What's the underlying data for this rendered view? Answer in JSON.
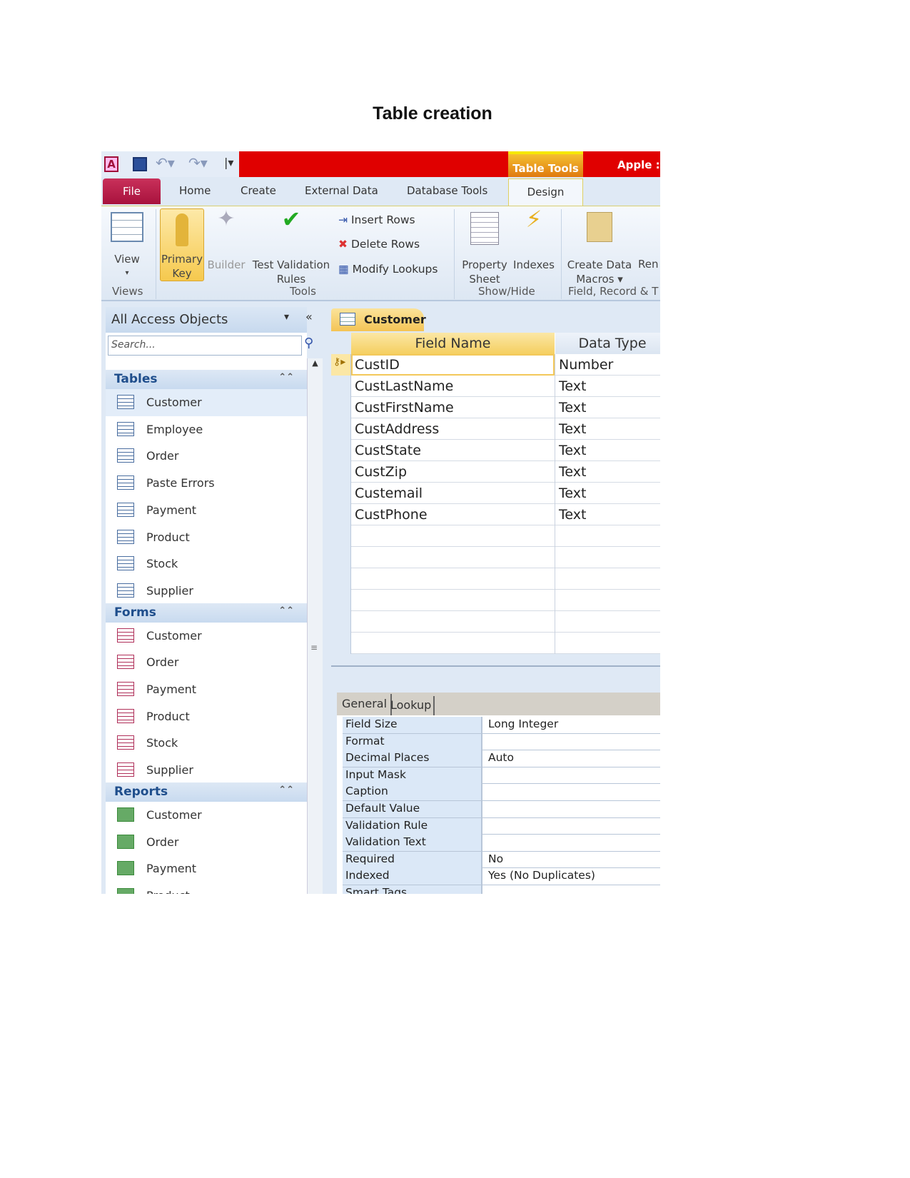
{
  "document": {
    "title": "Table creation"
  },
  "titlebar": {
    "table_tools": "Table Tools",
    "app_title": "Apple :"
  },
  "tabs": [
    "File",
    "Home",
    "Create",
    "External Data",
    "Database Tools",
    "Design"
  ],
  "ribbon": {
    "view": "View",
    "primary_key_1": "Primary",
    "primary_key_2": "Key",
    "builder": "Builder",
    "test_validation_1": "Test Validation",
    "test_validation_2": "Rules",
    "insert_rows": "Insert Rows",
    "delete_rows": "Delete Rows",
    "modify_lookups": "Modify Lookups",
    "property_sheet_1": "Property",
    "property_sheet_2": "Sheet",
    "indexes": "Indexes",
    "create_data_1": "Create Data",
    "create_data_2": "Macros ▾",
    "ren": "Ren",
    "groups": {
      "views": "Views",
      "tools": "Tools",
      "show_hide": "Show/Hide",
      "field_record": "Field, Record & T"
    }
  },
  "nav": {
    "header": "All Access Objects",
    "search_placeholder": "Search...",
    "sections": [
      {
        "label": "Tables",
        "items": [
          "Customer",
          "Employee",
          "Order",
          "Paste Errors",
          "Payment",
          "Product",
          "Stock",
          "Supplier"
        ]
      },
      {
        "label": "Forms",
        "items": [
          "Customer",
          "Order",
          "Payment",
          "Product",
          "Stock",
          "Supplier"
        ]
      },
      {
        "label": "Reports",
        "items": [
          "Customer",
          "Order",
          "Payment",
          "Product"
        ]
      }
    ]
  },
  "main": {
    "doc_tab": "Customer",
    "columns": [
      "Field Name",
      "Data Type"
    ],
    "rows": [
      [
        "CustID",
        "Number"
      ],
      [
        "CustLastName",
        "Text"
      ],
      [
        "CustFirstName",
        "Text"
      ],
      [
        "CustAddress",
        "Text"
      ],
      [
        "CustState",
        "Text"
      ],
      [
        "CustZip",
        "Text"
      ],
      [
        "Custemail",
        "Text"
      ],
      [
        "CustPhone",
        "Text"
      ]
    ],
    "prop_tabs": [
      "General",
      "Lookup"
    ],
    "properties": [
      [
        "Field Size",
        "Long Integer"
      ],
      [
        "Format",
        ""
      ],
      [
        "Decimal Places",
        "Auto"
      ],
      [
        "Input Mask",
        ""
      ],
      [
        "Caption",
        ""
      ],
      [
        "Default Value",
        ""
      ],
      [
        "Validation Rule",
        ""
      ],
      [
        "Validation Text",
        ""
      ],
      [
        "Required",
        "No"
      ],
      [
        "Indexed",
        "Yes (No Duplicates)"
      ],
      [
        "Smart Tags",
        ""
      ]
    ]
  },
  "colors": {
    "title_red": "#e00000",
    "file_tab": "#b81c48",
    "table_tools": "#f0a020",
    "selected": "#f7d36b"
  }
}
